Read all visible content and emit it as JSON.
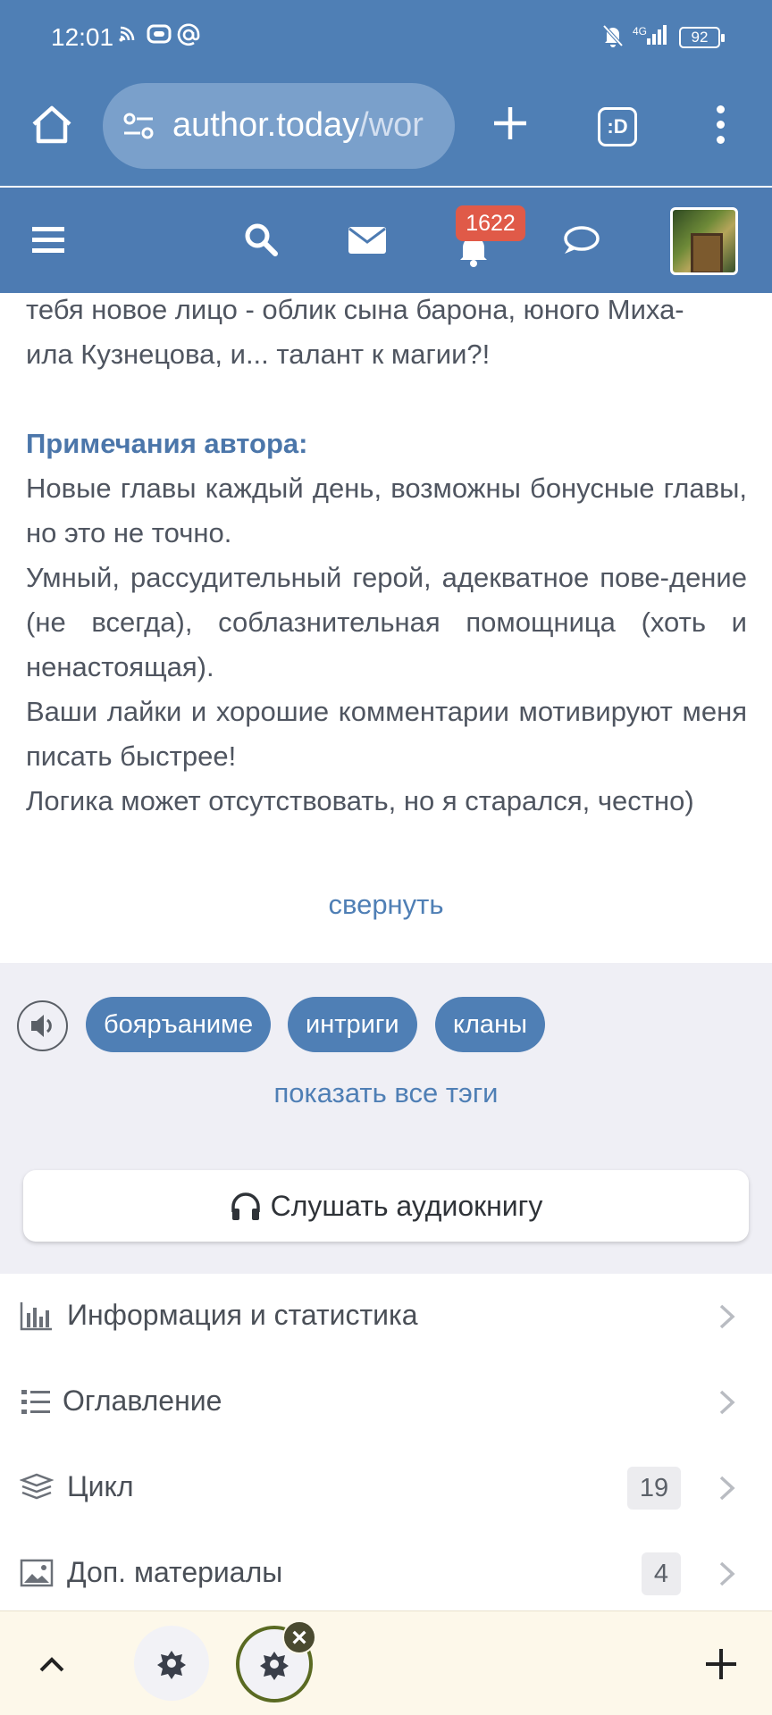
{
  "status": {
    "time": "12:01",
    "network": "4G",
    "battery": "92"
  },
  "browser": {
    "url_main": "author.today",
    "url_rest": "/wor",
    "tabs_label": ":D"
  },
  "sitenav": {
    "notifications": "1622"
  },
  "content": {
    "summary_line1": "тебя новое лицо - облик сына барона, юного Миха-",
    "summary_line2": "ила Кузнецова, и... талант к магии?!",
    "notes_title": "Примечания автора:",
    "notes": [
      "Новые главы каждый день, возможны бонусные главы, но это не точно.",
      "Умный, рассудительный герой, адекватное пове-дение (не всегда), соблазнительная помощница (хоть и ненастоящая).",
      "Ваши лайки и хорошие комментарии мотивируют меня писать быстрее!",
      "Логика может отсутствовать, но я старался, честно)"
    ],
    "collapse": "свернуть"
  },
  "tags": {
    "items": [
      "бояръаниме",
      "интриги",
      "кланы"
    ],
    "show_all": "показать все тэги",
    "audio_button": "Слушать аудиокнигу"
  },
  "menu": [
    {
      "label": "Информация и статистика",
      "count": "",
      "icon": "bar-chart-icon"
    },
    {
      "label": "Оглавление",
      "count": "",
      "icon": "list-icon"
    },
    {
      "label": "Цикл",
      "count": "19",
      "icon": "books-icon"
    },
    {
      "label": "Доп. материалы",
      "count": "4",
      "icon": "image-icon"
    }
  ]
}
